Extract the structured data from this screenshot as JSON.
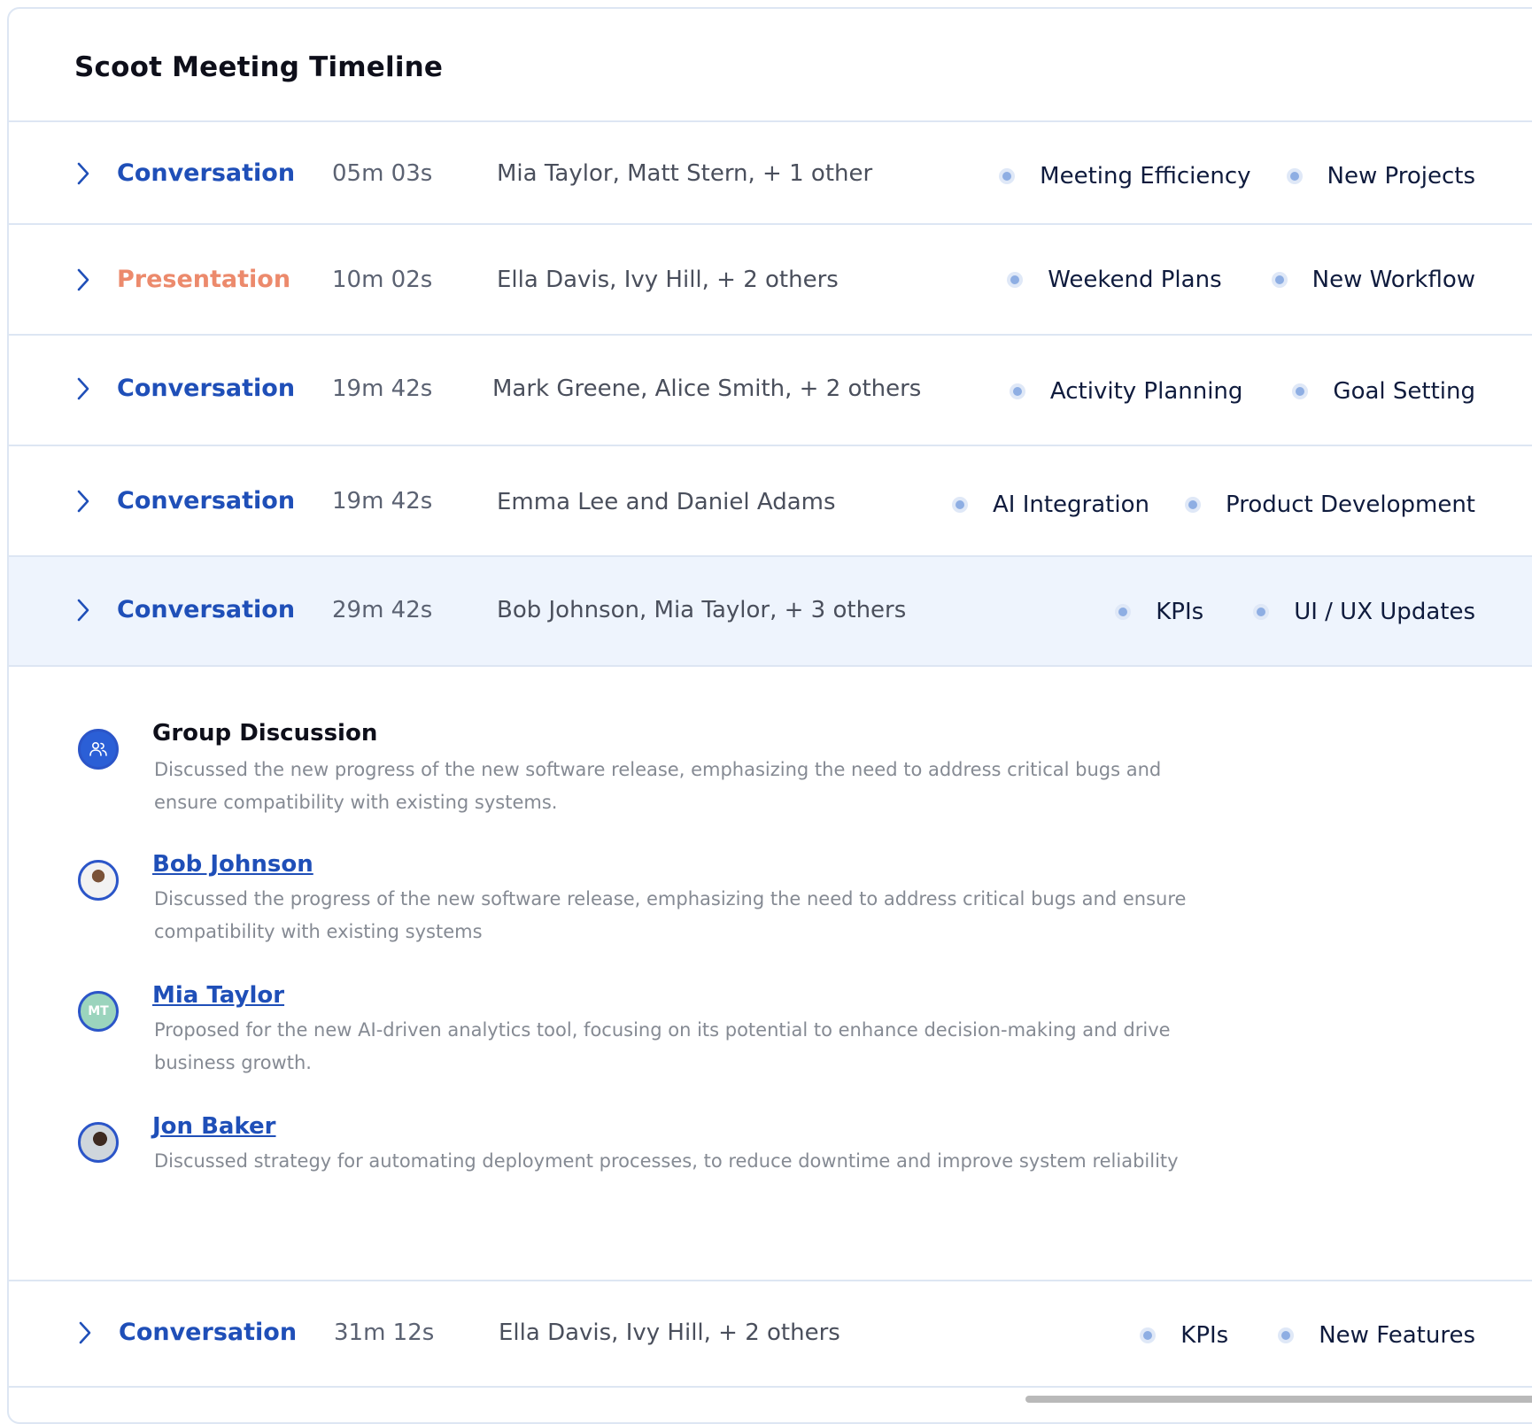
{
  "title": "Scoot Meeting Timeline",
  "rows": [
    {
      "type": "Conversation",
      "duration": "05m 03s",
      "participants": "Mia Taylor, Matt Stern, + 1 other",
      "tags": [
        "Meeting Efficiency",
        "New Projects"
      ]
    },
    {
      "type": "Presentation",
      "duration": "10m 02s",
      "participants": "Ella Davis, Ivy Hill,  + 2 others",
      "tags": [
        "Weekend Plans",
        "New Workflow"
      ]
    },
    {
      "type": "Conversation",
      "duration": "19m 42s",
      "participants": "Mark Greene, Alice Smith, + 2 others",
      "tags": [
        "Activity Planning",
        "Goal Setting"
      ]
    },
    {
      "type": "Conversation",
      "duration": "19m 42s",
      "participants": "Emma Lee and Daniel Adams",
      "tags": [
        "AI Integration",
        "Product Development"
      ]
    },
    {
      "type": "Conversation",
      "duration": "29m 42s",
      "participants": "Bob Johnson, Mia Taylor, + 3 others",
      "tags": [
        "KPIs",
        "UI / UX Updates"
      ]
    },
    {
      "type": "Conversation",
      "duration": "31m 12s",
      "participants": "Ella Davis, Ivy Hill,  + 2 others",
      "tags": [
        "KPIs",
        "New Features"
      ]
    }
  ],
  "details": [
    {
      "name": "Group Discussion",
      "text": "Discussed the new progress of the new software release, emphasizing the need to address critical bugs and ensure compatibility with existing systems."
    },
    {
      "name": "Bob Johnson",
      "text": "Discussed the progress of the new software release, emphasizing the need to address critical bugs and ensure compatibility with existing systems"
    },
    {
      "name": "Mia Taylor",
      "initials": "MT",
      "text": "Proposed for the new AI-driven analytics tool, focusing on its potential to enhance decision-making and drive business growth."
    },
    {
      "name": "Jon Baker",
      "text": "Discussed strategy for automating deployment processes, to reduce downtime and improve system reliability"
    }
  ],
  "colors": {
    "accent": "#1f4fb8",
    "presentation": "#ec8a6c",
    "active_row_bg": "#eef4fd",
    "border": "#dde6f3"
  },
  "icons": {
    "expand": "chevron-right-icon",
    "tag": "dot-icon",
    "group": "group-icon"
  }
}
